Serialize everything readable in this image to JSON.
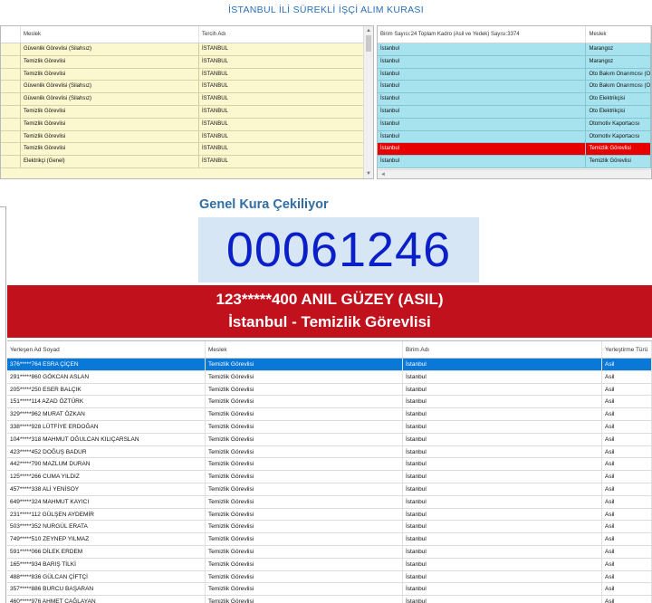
{
  "title": "İSTANBUL İLİ SÜREKLİ İŞÇİ ALIM KURASI",
  "top_left": {
    "headers": [
      "Meslek",
      "Tercih Adı"
    ],
    "rows": [
      [
        "Güvenlik Görevlisi (Silahsız)",
        "İSTANBUL"
      ],
      [
        "Temizlik Görevlisi",
        "İSTANBUL"
      ],
      [
        "Temizlik Görevlisi",
        "İSTANBUL"
      ],
      [
        "Güvenlik Görevlisi (Silahsız)",
        "İSTANBUL"
      ],
      [
        "Güvenlik Görevlisi (Silahsız)",
        "İSTANBUL"
      ],
      [
        "Temizlik Görevlisi",
        "İSTANBUL"
      ],
      [
        "Temizlik Görevlisi",
        "İSTANBUL"
      ],
      [
        "Temizlik Görevlisi",
        "İSTANBUL"
      ],
      [
        "Temizlik Görevlisi",
        "İSTANBUL"
      ],
      [
        "Elektrikçi (Genel)",
        "İSTANBUL"
      ]
    ]
  },
  "top_right": {
    "headers": [
      "Birim Sayısı:24 Toplam Kadro (Asil ve Yedek) Sayısı:3374",
      "Meslek"
    ],
    "rows": [
      [
        "İstanbul",
        "Marangoz"
      ],
      [
        "İstanbul",
        "Marangoz"
      ],
      [
        "İstanbul",
        "Oto Bakım Onarımcısı (O"
      ],
      [
        "İstanbul",
        "Oto Bakım Onarımcısı (O"
      ],
      [
        "İstanbul",
        "Oto Elektrikçisi"
      ],
      [
        "İstanbul",
        "Oto Elektrikçisi"
      ],
      [
        "İstanbul",
        "Otomotiv Kaportacısı"
      ],
      [
        "İstanbul",
        "Otomotiv Kaportacısı"
      ],
      [
        "İstanbul",
        "Temizlik Görevlisi"
      ],
      [
        "İstanbul",
        "Temizlik Görevlisi"
      ]
    ],
    "selected_index": 8
  },
  "draw_title": "Genel Kura Çekiliyor",
  "draw_number": "00061246",
  "banner": {
    "line1": "123*****400 ANIL GÜZEY (ASIL)",
    "line2": "İstanbul - Temizlik Görevlisi"
  },
  "bottom": {
    "headers": [
      "Yerleşen Ad Soyad",
      "Meslek",
      "Birim Adı",
      "Yerleştirme Türü"
    ],
    "rows": [
      [
        "376*****764 ESRA ÇİÇEN",
        "Temizlik Görevlisi",
        "İstanbul",
        "Asil"
      ],
      [
        "291*****860 GÖKCAN ASLAN",
        "Temizlik Görevlisi",
        "İstanbul",
        "Asil"
      ],
      [
        "205*****250 ESER BALÇIK",
        "Temizlik Görevlisi",
        "İstanbul",
        "Asil"
      ],
      [
        "151*****114 AZAD ÖZTÜRK",
        "Temizlik Görevlisi",
        "İstanbul",
        "Asil"
      ],
      [
        "329*****962 MURAT ÖZKAN",
        "Temizlik Görevlisi",
        "İstanbul",
        "Asil"
      ],
      [
        "338*****928 LÜTFİYE ERDOĞAN",
        "Temizlik Görevlisi",
        "İstanbul",
        "Asil"
      ],
      [
        "104*****318 MAHMUT OĞULCAN KILIÇARSLAN",
        "Temizlik Görevlisi",
        "İstanbul",
        "Asil"
      ],
      [
        "423*****452 DOĞUŞ BADUR",
        "Temizlik Görevlisi",
        "İstanbul",
        "Asil"
      ],
      [
        "442*****790 MAZLUM DURAN",
        "Temizlik Görevlisi",
        "İstanbul",
        "Asil"
      ],
      [
        "125*****266 CUMA YILDIZ",
        "Temizlik Görevlisi",
        "İstanbul",
        "Asil"
      ],
      [
        "457*****338 ALİ YENİSOY",
        "Temizlik Görevlisi",
        "İstanbul",
        "Asil"
      ],
      [
        "649*****324 MAHMUT KAYICI",
        "Temizlik Görevlisi",
        "İstanbul",
        "Asil"
      ],
      [
        "231*****112 GÜLŞEN AYDEMİR",
        "Temizlik Görevlisi",
        "İstanbul",
        "Asil"
      ],
      [
        "503*****352 NURGÜL ERATA",
        "Temizlik Görevlisi",
        "İstanbul",
        "Asil"
      ],
      [
        "749*****510 ZEYNEP YILMAZ",
        "Temizlik Görevlisi",
        "İstanbul",
        "Asil"
      ],
      [
        "591*****066 DİLEK ERDEM",
        "Temizlik Görevlisi",
        "İstanbul",
        "Asil"
      ],
      [
        "165*****934 BARIŞ TİLKİ",
        "Temizlik Görevlisi",
        "İstanbul",
        "Asil"
      ],
      [
        "488*****836 GÜLCAN ÇİFTÇİ",
        "Temizlik Görevlisi",
        "İstanbul",
        "Asil"
      ],
      [
        "357*****886 BURCU BAŞARAN",
        "Temizlik Görevlisi",
        "İstanbul",
        "Asil"
      ],
      [
        "460*****976 AHMET ÇAĞLAYAN",
        "Temizlik Görevlisi",
        "İstanbul",
        "Asil"
      ]
    ],
    "selected_index": 0
  },
  "colors": {
    "title_blue": "#2a6fb8",
    "banner_red": "#c0111c",
    "number_blue": "#0a1fc8",
    "selected_blue": "#0a78d7",
    "selected_red": "#e60000",
    "cyan_row": "#a6e3ef",
    "yellow_grid": "#fbf7cf"
  }
}
